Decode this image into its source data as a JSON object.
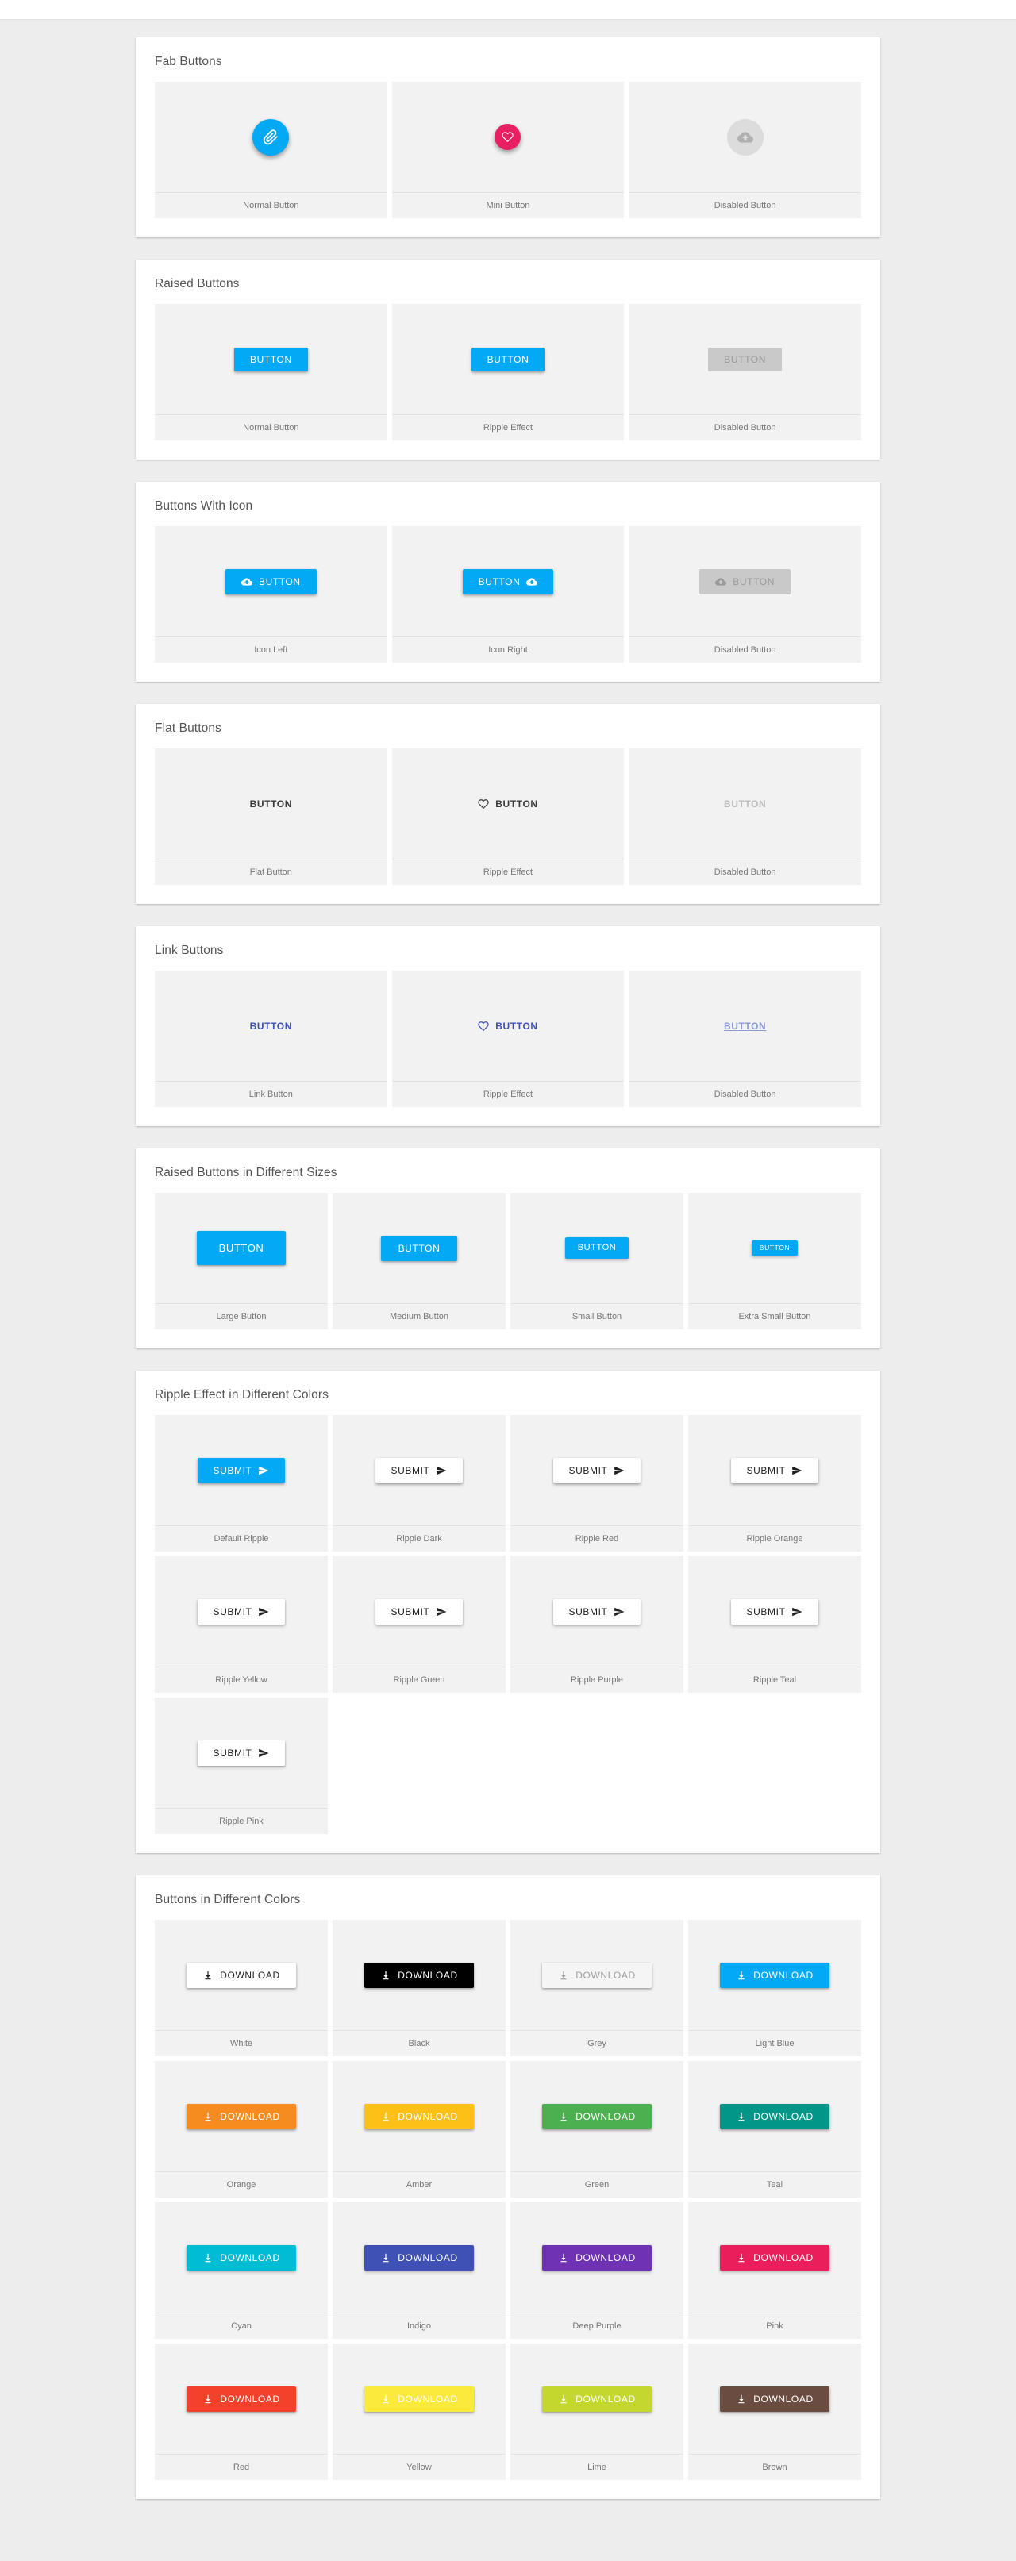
{
  "theme": {
    "page_bg": "#ededed",
    "card_bg": "#ffffff",
    "tile_bg": "#f2f2f2",
    "primary": "#03a9f4",
    "pink": "#e91e63",
    "disabled_bg": "#c9c9c9",
    "disabled_text": "#9a9a9a",
    "link": "#3f51b5",
    "flat_text": "#3a3a3a"
  },
  "sections": [
    {
      "title": "Fab Buttons",
      "columns": 3,
      "kind": "fab",
      "items": [
        {
          "label": "Normal Button",
          "icon": "paperclip-icon",
          "bg": "#03a9f4",
          "fg": "#ffffff",
          "size": "normal",
          "disabled": false
        },
        {
          "label": "Mini Button",
          "icon": "heart-outline-icon",
          "bg": "#e91e63",
          "fg": "#ffffff",
          "size": "mini",
          "disabled": false
        },
        {
          "label": "Disabled Button",
          "icon": "cloud-upload-icon",
          "bg": "#dcdcdc",
          "fg": "#b0b0b0",
          "size": "normal",
          "disabled": true
        }
      ]
    },
    {
      "title": "Raised Buttons",
      "columns": 3,
      "kind": "raised",
      "items": [
        {
          "label": "Normal Button",
          "text": "BUTTON",
          "bg": "#03a9f4",
          "fg": "#ffffff",
          "disabled": false
        },
        {
          "label": "Ripple Effect",
          "text": "BUTTON",
          "bg": "#03a9f4",
          "fg": "#ffffff",
          "disabled": false
        },
        {
          "label": "Disabled Button",
          "text": "BUTTON",
          "bg": "#c9c9c9",
          "fg": "#9a9a9a",
          "disabled": true
        }
      ]
    },
    {
      "title": "Buttons With Icon",
      "columns": 3,
      "kind": "raised-icon",
      "items": [
        {
          "label": "Icon Left",
          "text": "BUTTON",
          "icon": "cloud-upload-icon",
          "icon_side": "left",
          "bg": "#03a9f4",
          "fg": "#ffffff",
          "disabled": false
        },
        {
          "label": "Icon Right",
          "text": "BUTTON",
          "icon": "cloud-upload-icon",
          "icon_side": "right",
          "bg": "#03a9f4",
          "fg": "#ffffff",
          "disabled": false
        },
        {
          "label": "Disabled Button",
          "text": "BUTTON",
          "icon": "cloud-upload-icon",
          "icon_side": "left",
          "bg": "#c9c9c9",
          "fg": "#9a9a9a",
          "disabled": true
        }
      ]
    },
    {
      "title": "Flat Buttons",
      "columns": 3,
      "kind": "flat",
      "items": [
        {
          "label": "Flat Button",
          "text": "BUTTON",
          "icon": null,
          "fg": "#3a3a3a",
          "disabled": false
        },
        {
          "label": "Ripple Effect",
          "text": "BUTTON",
          "icon": "heart-outline-icon",
          "icon_side": "left",
          "fg": "#3a3a3a",
          "disabled": false
        },
        {
          "label": "Disabled Button",
          "text": "BUTTON",
          "icon": null,
          "fg": "#bdbdbd",
          "disabled": true
        }
      ]
    },
    {
      "title": "Link Buttons",
      "columns": 3,
      "kind": "link",
      "items": [
        {
          "label": "Link Button",
          "text": "BUTTON",
          "icon": null,
          "fg": "#3f51b5",
          "disabled": false,
          "underline": false
        },
        {
          "label": "Ripple Effect",
          "text": "BUTTON",
          "icon": "heart-outline-icon",
          "icon_side": "left",
          "fg": "#3f51b5",
          "disabled": false,
          "underline": false
        },
        {
          "label": "Disabled Button",
          "text": "BUTTON",
          "icon": null,
          "fg": "#8c9bd4",
          "disabled": true,
          "underline": true
        }
      ]
    },
    {
      "title": "Raised Buttons in Different Sizes",
      "columns": 4,
      "kind": "sizes",
      "items": [
        {
          "label": "Large Button",
          "text": "BUTTON",
          "size": "lg",
          "bg": "#03a9f4",
          "fg": "#ffffff"
        },
        {
          "label": "Medium Button",
          "text": "BUTTON",
          "size": "md",
          "bg": "#03a9f4",
          "fg": "#ffffff"
        },
        {
          "label": "Small Button",
          "text": "BUTTON",
          "size": "sm",
          "bg": "#03a9f4",
          "fg": "#ffffff"
        },
        {
          "label": "Extra Small Button",
          "text": "BUTTON",
          "size": "xs",
          "bg": "#03a9f4",
          "fg": "#ffffff"
        }
      ]
    },
    {
      "title": "Ripple Effect in Different Colors",
      "columns": 4,
      "kind": "ripple",
      "items": [
        {
          "label": "Default Ripple",
          "text": "SUBMIT",
          "icon": "send-icon",
          "bg": "#03a9f4",
          "fg": "#ffffff"
        },
        {
          "label": "Ripple Dark",
          "text": "SUBMIT",
          "icon": "send-icon",
          "bg": "#ffffff",
          "fg": "#212121"
        },
        {
          "label": "Ripple Red",
          "text": "SUBMIT",
          "icon": "send-icon",
          "bg": "#ffffff",
          "fg": "#212121"
        },
        {
          "label": "Ripple Orange",
          "text": "SUBMIT",
          "icon": "send-icon",
          "bg": "#ffffff",
          "fg": "#212121"
        },
        {
          "label": "Ripple Yellow",
          "text": "SUBMIT",
          "icon": "send-icon",
          "bg": "#ffffff",
          "fg": "#212121"
        },
        {
          "label": "Ripple Green",
          "text": "SUBMIT",
          "icon": "send-icon",
          "bg": "#ffffff",
          "fg": "#212121"
        },
        {
          "label": "Ripple Purple",
          "text": "SUBMIT",
          "icon": "send-icon",
          "bg": "#ffffff",
          "fg": "#212121"
        },
        {
          "label": "Ripple Teal",
          "text": "SUBMIT",
          "icon": "send-icon",
          "bg": "#ffffff",
          "fg": "#212121"
        },
        {
          "label": "Ripple Pink",
          "text": "SUBMIT",
          "icon": "send-icon",
          "bg": "#ffffff",
          "fg": "#212121"
        }
      ]
    },
    {
      "title": "Buttons in Different Colors",
      "columns": 4,
      "kind": "colors",
      "items": [
        {
          "label": "White",
          "text": "DOWNLOAD",
          "icon": "download-icon",
          "bg": "#ffffff",
          "fg": "#212121"
        },
        {
          "label": "Black",
          "text": "DOWNLOAD",
          "icon": "download-icon",
          "bg": "#000000",
          "fg": "#ffffff"
        },
        {
          "label": "Grey",
          "text": "DOWNLOAD",
          "icon": "download-icon",
          "bg": "#f5f5f5",
          "fg": "#9e9e9e"
        },
        {
          "label": "Light Blue",
          "text": "DOWNLOAD",
          "icon": "download-icon",
          "bg": "#03a9f4",
          "fg": "#ffffff"
        },
        {
          "label": "Orange",
          "text": "DOWNLOAD",
          "icon": "download-icon",
          "bg": "#f68c20",
          "fg": "#ffffff"
        },
        {
          "label": "Amber",
          "text": "DOWNLOAD",
          "icon": "download-icon",
          "bg": "#fcc016",
          "fg": "#ffffff"
        },
        {
          "label": "Green",
          "text": "DOWNLOAD",
          "icon": "download-icon",
          "bg": "#4caf50",
          "fg": "#ffffff"
        },
        {
          "label": "Teal",
          "text": "DOWNLOAD",
          "icon": "download-icon",
          "bg": "#029688",
          "fg": "#ffffff"
        },
        {
          "label": "Cyan",
          "text": "DOWNLOAD",
          "icon": "download-icon",
          "bg": "#00bcd4",
          "fg": "#ffffff"
        },
        {
          "label": "Indigo",
          "text": "DOWNLOAD",
          "icon": "download-icon",
          "bg": "#3f51b5",
          "fg": "#ffffff"
        },
        {
          "label": "Deep Purple",
          "text": "DOWNLOAD",
          "icon": "download-icon",
          "bg": "#6f32b5",
          "fg": "#ffffff"
        },
        {
          "label": "Pink",
          "text": "DOWNLOAD",
          "icon": "download-icon",
          "bg": "#e91e5a",
          "fg": "#ffffff"
        },
        {
          "label": "Red",
          "text": "DOWNLOAD",
          "icon": "download-icon",
          "bg": "#f4412c",
          "fg": "#ffffff"
        },
        {
          "label": "Yellow",
          "text": "DOWNLOAD",
          "icon": "download-icon",
          "bg": "#fbe93c",
          "fg": "#ffffff"
        },
        {
          "label": "Lime",
          "text": "DOWNLOAD",
          "icon": "download-icon",
          "bg": "#c4d72e",
          "fg": "#ffffff"
        },
        {
          "label": "Brown",
          "text": "DOWNLOAD",
          "icon": "download-icon",
          "bg": "#6b4c41",
          "fg": "#ffffff"
        }
      ]
    }
  ]
}
